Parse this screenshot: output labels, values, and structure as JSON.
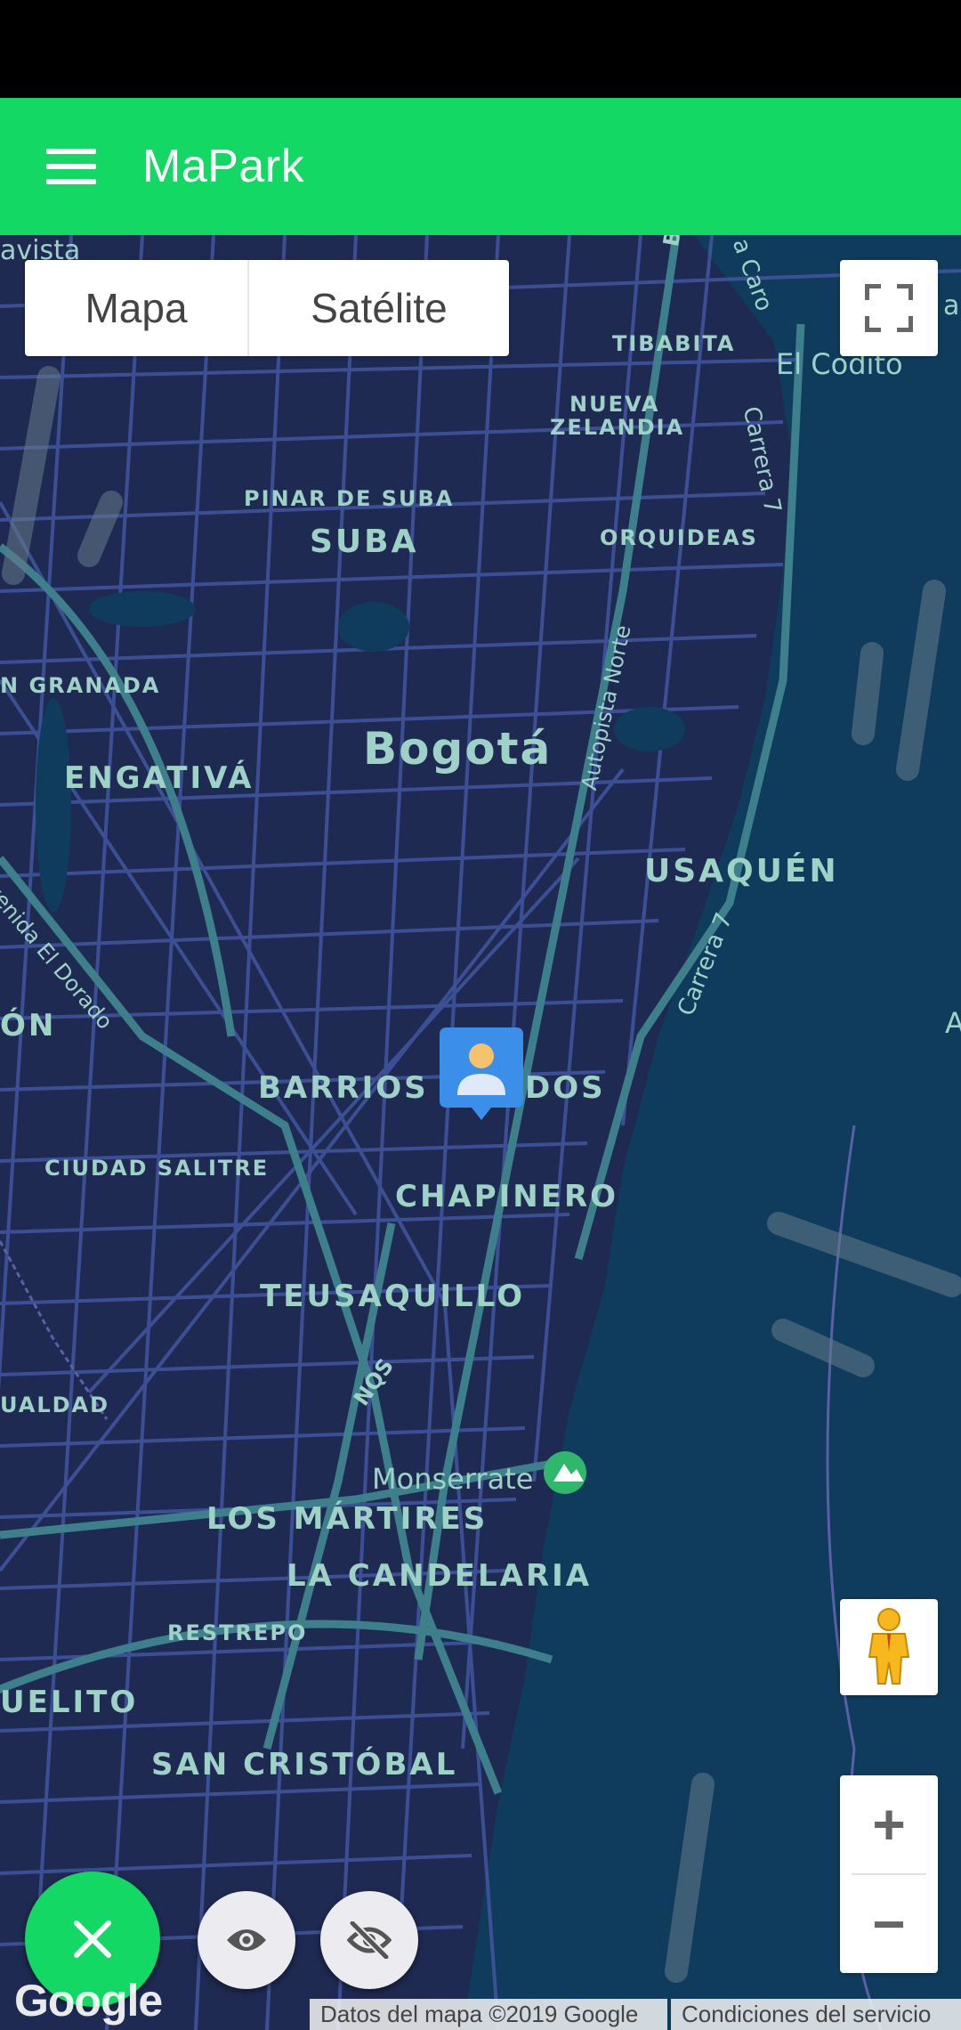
{
  "app": {
    "title": "MaPark"
  },
  "map_type": {
    "map_label": "Mapa",
    "satellite_label": "Satélite",
    "selected": "Mapa"
  },
  "labels": {
    "bogota": "Bogotá",
    "suba": "SUBA",
    "pinar_de_suba": "PINAR DE SUBA",
    "engativa": "ENGATIVÁ",
    "granada": "N GRANADA",
    "usaquen": "USAQUÉN",
    "tibabita": "TIBABITA",
    "nueva_1": "NUEVA",
    "nueva_2": "ZELANDIA",
    "orquideas": "ORQUIDEAS",
    "el_codito": "El Codito",
    "barrios": "BARRIOS",
    "unidos": "DOS",
    "ciudad_salitre": "CIUDAD SALITRE",
    "chapinero": "CHAPINERO",
    "teusaquillo": "TEUSAQUILLO",
    "monserrate": "Monserrate",
    "los_martires": "LOS MÁRTIRES",
    "la_candelaria": "LA CANDELARIA",
    "restrepo": "RESTREPO",
    "uelito": "UELITO",
    "san_cristobal": "SAN CRISTÓBAL",
    "ualdad": "UALDAD",
    "on": "ÓN",
    "avista": "avista",
    "autopista_norte": "Autopista Norte",
    "carrera7_a": "Carrera 7",
    "carrera7_b": "Carrera 7",
    "carrera7_c": "Carrera 7",
    "avenida_el_dorado": "venida El Dorado",
    "nqs": "NQS",
    "bogota_road": "Bogotá",
    "a_caro": "a Caro",
    "right_a": "A",
    "right_an": "an"
  },
  "attribution": {
    "data": "Datos del mapa ©2019 Google",
    "terms": "Condiciones del servicio",
    "logo": "Google"
  },
  "controls": {
    "zoom_in": "+",
    "zoom_out": "−"
  },
  "colors": {
    "app_bar": "#14d864",
    "map_land": "#1f2a52",
    "map_water_hills": "#0f3c5c",
    "road": "#4a5fa8",
    "highway": "#3d7f8a",
    "label": "#9fd2c6",
    "fab_green": "#14d864"
  },
  "icons": {
    "menu": "hamburger-menu-icon",
    "fullscreen": "fullscreen-icon",
    "pegman": "street-view-pegman-icon",
    "user_marker": "user-location-marker-icon",
    "poi": "mountain-poi-icon",
    "close": "close-icon",
    "eye": "eye-icon",
    "eye_off": "eye-off-icon"
  }
}
